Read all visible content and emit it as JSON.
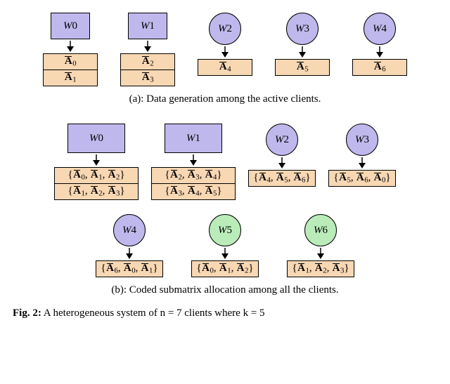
{
  "figA": {
    "caption": "(a): Data generation among the active clients.",
    "units": [
      {
        "shape": "rect",
        "color": "purple",
        "worker": "W0",
        "stack": [
          "Ā0",
          "Ā1"
        ]
      },
      {
        "shape": "rect",
        "color": "purple",
        "worker": "W1",
        "stack": [
          "Ā2",
          "Ā3"
        ]
      },
      {
        "shape": "circle",
        "color": "purple",
        "worker": "W2",
        "stack": [
          "Ā4"
        ]
      },
      {
        "shape": "circle",
        "color": "purple",
        "worker": "W3",
        "stack": [
          "Ā5"
        ]
      },
      {
        "shape": "circle",
        "color": "purple",
        "worker": "W4",
        "stack": [
          "Ā6"
        ]
      }
    ]
  },
  "figB": {
    "caption": "(b): Coded submatrix allocation among all the clients.",
    "row1": [
      {
        "shape": "rect",
        "color": "purple",
        "worker": "W0",
        "size": "m",
        "stack": [
          "{Ā0, Ā1, Ā2}",
          "{Ā1, Ā2, Ā3}"
        ]
      },
      {
        "shape": "rect",
        "color": "purple",
        "worker": "W1",
        "size": "m",
        "stack": [
          "{Ā2, Ā3, Ā4}",
          "{Ā3, Ā4, Ā5}"
        ]
      },
      {
        "shape": "circle",
        "color": "purple",
        "worker": "W2",
        "size": "s",
        "stack": [
          "{Ā4, Ā5, Ā6}"
        ]
      },
      {
        "shape": "circle",
        "color": "purple",
        "worker": "W3",
        "size": "s",
        "stack": [
          "{Ā5, Ā6, Ā0}"
        ]
      }
    ],
    "row2": [
      {
        "shape": "circle",
        "color": "purple",
        "worker": "W4",
        "size": "s",
        "stack": [
          "{Ā6, Ā0, Ā1}"
        ]
      },
      {
        "shape": "circle",
        "color": "green",
        "worker": "W5",
        "size": "s",
        "stack": [
          "{Ā0, Ā1, Ā2}"
        ]
      },
      {
        "shape": "circle",
        "color": "green",
        "worker": "W6",
        "size": "s",
        "stack": [
          "{Ā1, Ā2, Ā3}"
        ]
      }
    ]
  },
  "figure_caption_prefix": "Fig. 2:",
  "figure_caption_text": " A heterogeneous system of n = 7 clients where k = 5",
  "colors": {
    "purple": "#bfb8ec",
    "green": "#baecba",
    "databox": "#f8d7b3"
  }
}
